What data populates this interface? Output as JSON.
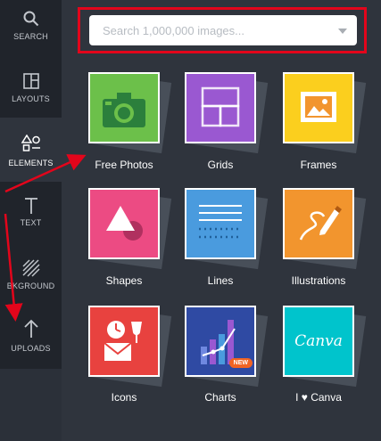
{
  "sidebar": {
    "items": [
      {
        "label": "SEARCH",
        "icon": "search-icon"
      },
      {
        "label": "LAYOUTS",
        "icon": "layouts-icon"
      },
      {
        "label": "ELEMENTS",
        "icon": "elements-icon"
      },
      {
        "label": "TEXT",
        "icon": "text-icon"
      },
      {
        "label": "BKGROUND",
        "icon": "background-icon"
      },
      {
        "label": "UPLOADS",
        "icon": "upload-icon"
      }
    ]
  },
  "search": {
    "placeholder": "Search 1,000,000 images..."
  },
  "elements": [
    {
      "label": "Free Photos",
      "color": "#6cc04a",
      "icon": "camera-icon"
    },
    {
      "label": "Grids",
      "color": "#9a58d1",
      "icon": "grid-icon"
    },
    {
      "label": "Frames",
      "color": "#fbcf1e",
      "icon": "frame-icon"
    },
    {
      "label": "Shapes",
      "color": "#ec4b83",
      "icon": "shapes-icon"
    },
    {
      "label": "Lines",
      "color": "#4a9bde",
      "icon": "lines-icon"
    },
    {
      "label": "Illustrations",
      "color": "#f2952e",
      "icon": "pencil-icon"
    },
    {
      "label": "Icons",
      "color": "#e8423f",
      "icon": "clock-wine-icon"
    },
    {
      "label": "Charts",
      "color": "#2f4aa3",
      "icon": "chart-icon",
      "badge": "NEW"
    },
    {
      "label": "I ♥ Canva",
      "color": "#00c4cc",
      "icon": "canva-logo-icon",
      "logo_text": "Canva"
    }
  ],
  "colors": {
    "highlight": "#e3051b",
    "annotation_arrow": "#e3051b"
  }
}
